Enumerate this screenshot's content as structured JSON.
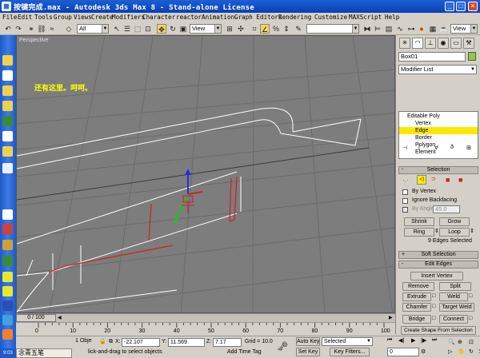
{
  "title": "按键完成.max - Autodesk 3ds Max 8 - Stand-alone License",
  "menu": [
    "File",
    "Edit",
    "Tools",
    "Group",
    "Views",
    "Create",
    "Modifiers",
    "Character",
    "reactor",
    "Animation",
    "Graph Editors",
    "Rendering",
    "Customize",
    "MAXScript",
    "Help"
  ],
  "toolbar": {
    "selection_filter": "All",
    "ref_coord": "View",
    "named_sets": "",
    "view_label": "View"
  },
  "viewport": {
    "label": "Perspective",
    "annotation": "还有这里。呵呵。",
    "colors": {
      "bg": "#7d7d7d",
      "grid": "#6b6b6b",
      "edge": "#ffffff",
      "selected_edge": "#d02020"
    }
  },
  "command_panel": {
    "object_name": "Box01",
    "object_color": "#96c83c",
    "modifier_list": "Modifier List",
    "stack": [
      {
        "label": "Editable Poly",
        "level": 0,
        "selected": false
      },
      {
        "label": "Vertex",
        "level": 1,
        "selected": false
      },
      {
        "label": "Edge",
        "level": 1,
        "selected": true
      },
      {
        "label": "Border",
        "level": 1,
        "selected": false
      },
      {
        "label": "Polygon",
        "level": 1,
        "selected": false
      },
      {
        "label": "Element",
        "level": 1,
        "selected": false
      }
    ],
    "selection": {
      "header": "Selection",
      "by_vertex": "By Vertex",
      "ignore_backfacing": "Ignore Backfacing",
      "by_angle": "By Angle:",
      "angle_value": "45.0",
      "shrink": "Shrink",
      "grow": "Grow",
      "ring": "Ring",
      "loop": "Loop",
      "status": "9 Edges Selected"
    },
    "soft_selection": "Soft Selection",
    "edit_edges": {
      "header": "Edit Edges",
      "insert_vertex": "Insert Vertex",
      "remove": "Remove",
      "split": "Split",
      "extrude": "Extrude",
      "weld": "Weld",
      "chamfer": "Chamfer",
      "target_weld": "Target Weld",
      "bridge": "Bridge",
      "connect": "Connect",
      "create_shape": "Create Shape From Selection"
    }
  },
  "timeline": {
    "frame": "0 / 100",
    "ticks": [
      "0",
      "10",
      "20",
      "30",
      "40",
      "50",
      "60",
      "70",
      "80",
      "90",
      "100"
    ]
  },
  "status": {
    "objects": "1 Obje",
    "prompt": "lick-and-drag to select objects",
    "x_label": "X:",
    "x": "-22.107",
    "y_label": "Y:",
    "y": "11.569",
    "z_label": "Z:",
    "z": "7.17",
    "grid": "Grid = 10.0",
    "add_time_tag": "Add Time Tag",
    "auto_key": "Auto Key",
    "set_key": "Set Key",
    "selected": "Selected",
    "key_filters": "Key Filters...",
    "frame_field": "0"
  },
  "ime": "念青五笔",
  "clock": "9:03"
}
